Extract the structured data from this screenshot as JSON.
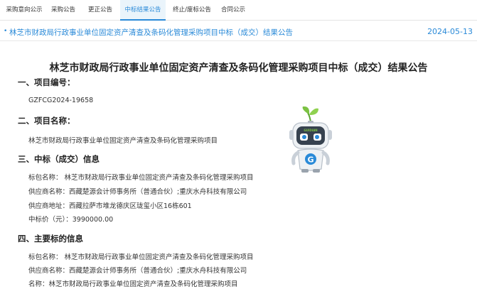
{
  "tabs": [
    {
      "label": "采购意向公示",
      "active": false
    },
    {
      "label": "采购公告",
      "active": false
    },
    {
      "label": "更正公告",
      "active": false
    },
    {
      "label": "中标结果公告",
      "active": true
    },
    {
      "label": "终止/废标公告",
      "active": false
    },
    {
      "label": "合同公示",
      "active": false
    }
  ],
  "listing": {
    "bullet": "•",
    "title": "林芝市财政局行政事业单位固定资产清查及条码化管理采购项目中标（成交）结果公告",
    "date": "2024-05-13"
  },
  "document": {
    "title": "林芝市财政局行政事业单位固定资产清查及条码化管理采购项目中标（成交）结果公告",
    "sections": [
      {
        "heading": "一、项目编号：",
        "lines": [
          "GZFCG2024-19658"
        ]
      },
      {
        "heading": "二、项目名称：",
        "lines": [
          "林芝市财政局行政事业单位固定资产清查及条码化管理采购项目"
        ]
      },
      {
        "heading": "三、中标（成交）信息",
        "lines": [
          "标包名称：  林芝市财政局行政事业单位固定资产清查及条码化管理采购项目",
          "供应商名称：西藏楚源会计师事务所（普通合伙）;重庆水舟科技有限公司",
          "供应商地址：西藏拉萨市堆龙德庆区珑玺小区16栋601",
          "中标价（元）：3990000.00"
        ]
      },
      {
        "heading": "四、主要标的信息",
        "lines": [
          "标包名称：  林芝市财政局行政事业单位固定资产清查及条码化管理采购项目",
          "供应商名称：西藏楚源会计师事务所（普通合伙）;重庆水舟科技有限公司",
          "名称：林芝市财政局行政事业单位固定资产清查及条码化管理采购项目"
        ]
      }
    ]
  },
  "mascot": {
    "screen_text": "GUIDIAN",
    "badge_letter": "G"
  },
  "colors": {
    "accent": "#2a8ad8",
    "active_tab_bg": "#eaf4fb",
    "leaf": "#7cc243"
  }
}
